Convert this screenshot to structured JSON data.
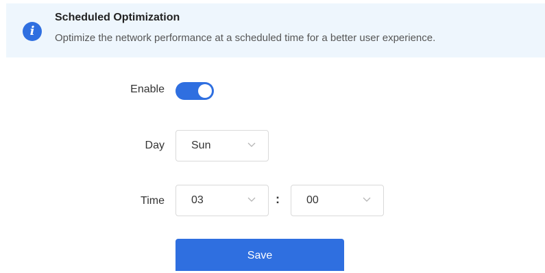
{
  "banner": {
    "icon": "info-icon",
    "icon_glyph": "i",
    "title": "Scheduled Optimization",
    "description": "Optimize the network performance at a scheduled time for a better user experience."
  },
  "form": {
    "enable": {
      "label": "Enable",
      "enabled": true
    },
    "day": {
      "label": "Day",
      "value": "Sun"
    },
    "time": {
      "label": "Time",
      "hour": "03",
      "separator": ":",
      "minute": "00"
    },
    "save_label": "Save"
  },
  "colors": {
    "accent": "#2f6fe0",
    "banner_bg": "#eef6fd"
  }
}
